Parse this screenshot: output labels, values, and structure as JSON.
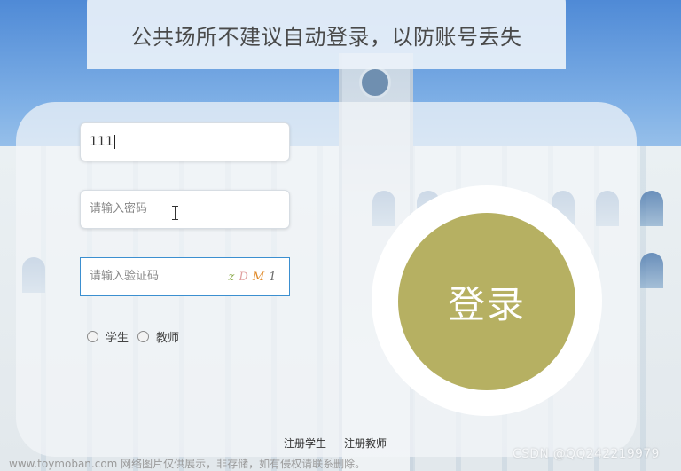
{
  "notice": {
    "text": "公共场所不建议自动登录，以防账号丢失"
  },
  "form": {
    "username_value": "111",
    "password_placeholder": "请输入密码",
    "captcha_placeholder": "请输入验证码",
    "captcha_chars": [
      "z",
      "D",
      "M",
      "1"
    ],
    "captcha_colors": [
      "#8aa848",
      "#e0a0a0",
      "#e08a2a",
      "#6a6a6a"
    ],
    "roles": [
      {
        "label": "学生"
      },
      {
        "label": "教师"
      }
    ],
    "login_label": "登录"
  },
  "links": {
    "register_student": "注册学生",
    "register_teacher": "注册教师"
  },
  "watermarks": {
    "left": "www.toymoban.com 网络图片仅供展示，非存储，如有侵权请联系删除。",
    "right": "CSDN @QQ242219979"
  },
  "colors": {
    "login_button": "#b6b062",
    "captcha_border": "#3b8fd0"
  }
}
